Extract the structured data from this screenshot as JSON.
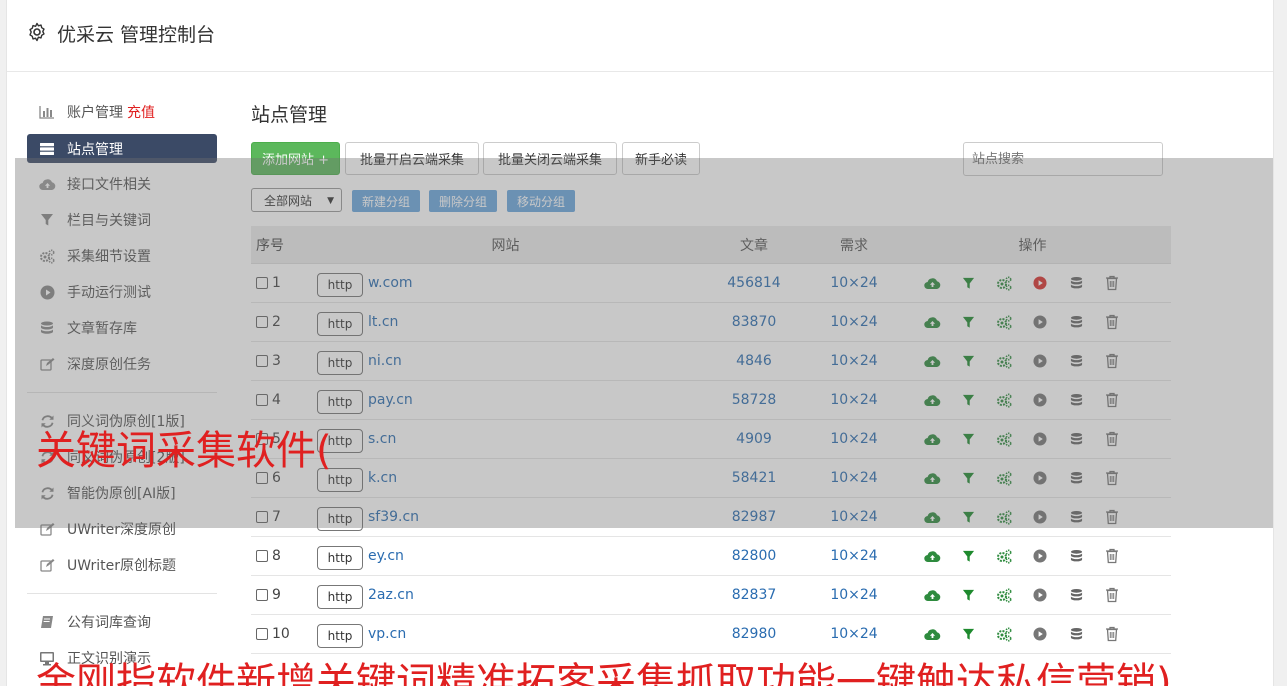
{
  "header": {
    "title": "优采云 管理控制台"
  },
  "sidebar": {
    "items": [
      {
        "label": "账户管理",
        "extra": "充值",
        "icon": "bar-chart-icon"
      },
      {
        "label": "站点管理",
        "icon": "server-icon",
        "active": true
      },
      {
        "label": "接口文件相关",
        "icon": "cloud-upload-icon"
      },
      {
        "label": "栏目与关键词",
        "icon": "filter-icon"
      },
      {
        "label": "采集细节设置",
        "icon": "cogs-icon"
      },
      {
        "label": "手动运行测试",
        "icon": "play-circle-icon"
      },
      {
        "label": "文章暂存库",
        "icon": "database-icon"
      },
      {
        "label": "深度原创任务",
        "icon": "edit-icon"
      }
    ],
    "items2": [
      {
        "label": "同义词伪原创[1版]",
        "icon": "refresh-icon"
      },
      {
        "label": "同义词伪原创[2版]",
        "icon": "refresh-icon"
      },
      {
        "label": "智能伪原创[AI版]",
        "icon": "refresh-icon"
      },
      {
        "label": "UWriter深度原创",
        "icon": "edit-icon"
      },
      {
        "label": "UWriter原创标题",
        "icon": "edit-icon"
      }
    ],
    "items3": [
      {
        "label": "公有词库查询",
        "icon": "book-icon"
      },
      {
        "label": "正文识别演示",
        "icon": "monitor-icon"
      }
    ]
  },
  "main": {
    "title": "站点管理",
    "buttons": {
      "add": "添加网站 +",
      "batch_on": "批量开启云端采集",
      "batch_off": "批量关闭云端采集",
      "guide": "新手必读"
    },
    "search_placeholder": "站点搜索",
    "group_select": "全部网站",
    "group_buttons": {
      "new": "新建分组",
      "delete": "删除分组",
      "move": "移动分组"
    },
    "table": {
      "headers": {
        "no": "序号",
        "site": "网站",
        "articles": "文章",
        "need": "需求",
        "ops": "操作"
      },
      "rows": [
        {
          "no": "1",
          "http": "http",
          "domain": "w.com",
          "articles": "456814",
          "need": "10×24",
          "running": true
        },
        {
          "no": "2",
          "http": "http",
          "domain": "lt.cn",
          "articles": "83870",
          "need": "10×24"
        },
        {
          "no": "3",
          "http": "http",
          "domain": "ni.cn",
          "articles": "4846",
          "need": "10×24"
        },
        {
          "no": "4",
          "http": "http",
          "domain": "pay.cn",
          "articles": "58728",
          "need": "10×24"
        },
        {
          "no": "5",
          "http": "http",
          "domain": "s.cn",
          "articles": "4909",
          "need": "10×24"
        },
        {
          "no": "6",
          "http": "http",
          "domain": "k.cn",
          "articles": "58421",
          "need": "10×24"
        },
        {
          "no": "7",
          "http": "http",
          "domain": "sf39.cn",
          "articles": "82987",
          "need": "10×24"
        },
        {
          "no": "8",
          "http": "http",
          "domain": "ey.cn",
          "articles": "82800",
          "need": "10×24"
        },
        {
          "no": "9",
          "http": "http",
          "domain": "2az.cn",
          "articles": "82837",
          "need": "10×24"
        },
        {
          "no": "10",
          "http": "http",
          "domain": "vp.cn",
          "articles": "82980",
          "need": "10×24"
        }
      ]
    }
  },
  "captions": {
    "line1": "关键词采集软件(",
    "line2": "金刚指软件新增关键词精准拓客采集抓取功能一键触达私信营销)"
  },
  "colors": {
    "accent_green": "#5cb85c",
    "link_blue": "#2a6cb0",
    "active_nav": "#3b4a66",
    "caption_red": "#e02020",
    "group_btn": "#6aa6de"
  }
}
